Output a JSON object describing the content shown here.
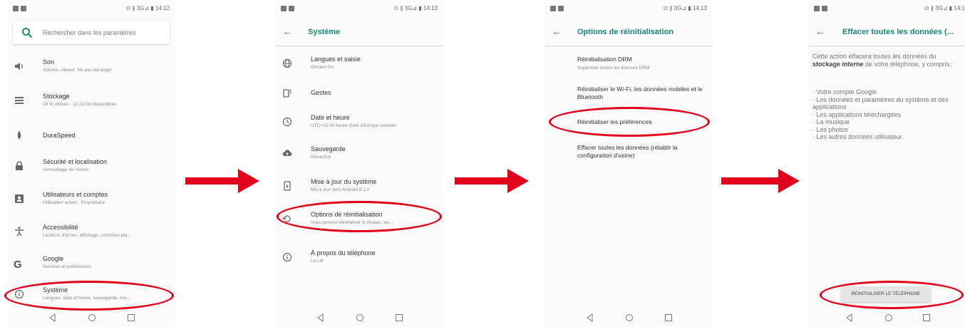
{
  "status_bar": {
    "screen1_right": "⊙ ∦ 3G⊿ ▮ 14:12",
    "screen2_right": "⊙ ∦ 3G⊿ ▮ 14:13",
    "screen3_right": "⊙ ∦ 3G⊿ ▮ 14:13",
    "screen4_right": "⊙ ∦ 3G⊿ ▮ 14:1"
  },
  "screen1": {
    "search_placeholder": "Rechercher dans les paramètres",
    "items": [
      {
        "title": "Son",
        "subtitle": "Volume, vibreur, Ne pas déranger",
        "icon": "volume-icon"
      },
      {
        "title": "Stockage",
        "subtitle": "24 % utilisés - 12,23 Go disponibles",
        "icon": "storage-icon"
      },
      {
        "title": "DuraSpeed",
        "subtitle": "",
        "icon": "rocket-icon"
      },
      {
        "title": "Sécurité et localisation",
        "subtitle": "Verrouillage de l'écran",
        "icon": "lock-icon"
      },
      {
        "title": "Utilisateurs et comptes",
        "subtitle": "Utilisateur actuel : Propriétaire",
        "icon": "account-icon"
      },
      {
        "title": "Accessibilité",
        "subtitle": "Lecteurs d'écran, affichage, contrôles par...",
        "icon": "accessibility-icon"
      },
      {
        "title": "Google",
        "subtitle": "Services et préférences",
        "icon": "google-icon"
      },
      {
        "title": "Système",
        "subtitle": "Langues, date et heure, sauvegarde, mis...",
        "icon": "info-icon"
      }
    ]
  },
  "screen2": {
    "title": "Système",
    "items": [
      {
        "title": "Langues et saisie",
        "subtitle": "Gboard Go",
        "icon": "globe-icon"
      },
      {
        "title": "Gestes",
        "subtitle": "",
        "icon": "gesture-icon"
      },
      {
        "title": "Date et heure",
        "subtitle": "UTC+02:00 heure d'été d'Europe centrale",
        "icon": "clock-icon"
      },
      {
        "title": "Sauvegarde",
        "subtitle": "Désactivé",
        "icon": "cloud-upload-icon"
      },
      {
        "title": "Mise à jour du système",
        "subtitle": "Mis à jour vers Android 8.1.0",
        "icon": "phone-update-icon"
      },
      {
        "title": "Options de réinitialisation",
        "subtitle": "Vous pouvez réinitialiser le réseau, les...",
        "icon": "restore-icon"
      },
      {
        "title": "À propos du téléphone",
        "subtitle": "Le Lift",
        "icon": "info-icon"
      }
    ]
  },
  "screen3": {
    "title": "Options de réinitialisation",
    "items": [
      {
        "title": "Réinitialisation DRM",
        "subtitle": "Supprimer toutes les licences DRM"
      },
      {
        "title": "Réinitialiser le Wi-Fi, les données mobiles et le Bluetooth",
        "subtitle": ""
      },
      {
        "title": "Réinitialiser les préférences",
        "subtitle": ""
      },
      {
        "title": "Effacer toutes les données (rétablir la configuration d'usine)",
        "subtitle": ""
      }
    ]
  },
  "screen4": {
    "title": "Effacer toutes les données (...",
    "desc_before": "Cette action effacera toutes les données du ",
    "desc_bold": "stockage interne",
    "desc_after": " de votre téléphone, y compris :",
    "bullets": [
      "· Votre compte Google",
      "· Les données et paramètres du système et des applications",
      "· Les applications téléchargées",
      "· La musique",
      "· Les photos",
      "· Les autres données utilisateur."
    ],
    "reset_button": "RÉINITIALISER LE TÉLÉPHONE"
  },
  "colors": {
    "accent": "#1a8a7a",
    "annotation_red": "#e3001b"
  }
}
